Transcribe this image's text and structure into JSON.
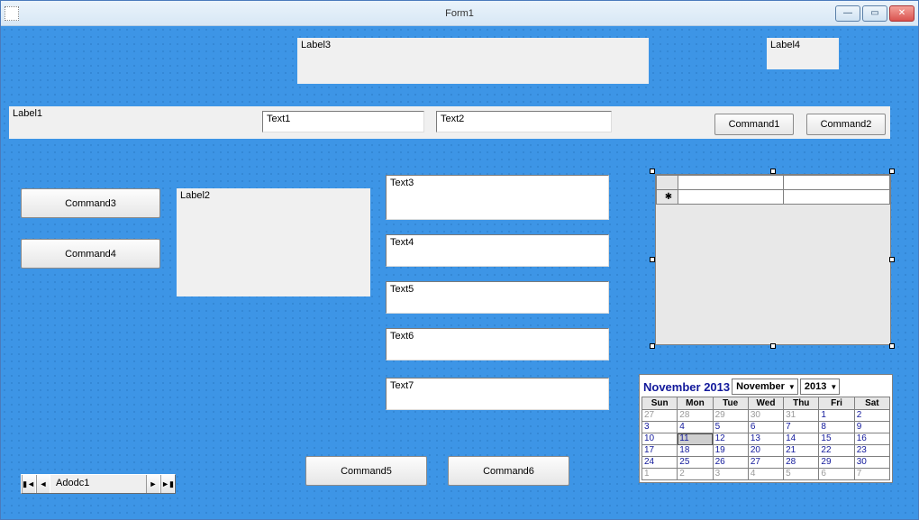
{
  "window": {
    "title": "Form1"
  },
  "labels": {
    "label1": "Label1",
    "label2": "Label2",
    "label3": "Label3",
    "label4": "Label4"
  },
  "texts": {
    "text1": "Text1",
    "text2": "Text2",
    "text3": "Text3",
    "text4": "Text4",
    "text5": "Text5",
    "text6": "Text6",
    "text7": "Text7"
  },
  "buttons": {
    "command1": "Command1",
    "command2": "Command2",
    "command3": "Command3",
    "command4": "Command4",
    "command5": "Command5",
    "command6": "Command6"
  },
  "adodc": {
    "caption": "Adodc1"
  },
  "grid": {
    "new_row_marker": "✱"
  },
  "calendar": {
    "title": "November 2013",
    "month_select": "November",
    "year_select": "2013",
    "day_headers": [
      "Sun",
      "Mon",
      "Tue",
      "Wed",
      "Thu",
      "Fri",
      "Sat"
    ],
    "rows": [
      [
        {
          "d": "27",
          "dim": true
        },
        {
          "d": "28",
          "dim": true
        },
        {
          "d": "29",
          "dim": true
        },
        {
          "d": "30",
          "dim": true
        },
        {
          "d": "31",
          "dim": true
        },
        {
          "d": "1"
        },
        {
          "d": "2"
        }
      ],
      [
        {
          "d": "3"
        },
        {
          "d": "4"
        },
        {
          "d": "5"
        },
        {
          "d": "6"
        },
        {
          "d": "7"
        },
        {
          "d": "8"
        },
        {
          "d": "9"
        }
      ],
      [
        {
          "d": "10"
        },
        {
          "d": "11",
          "today": true
        },
        {
          "d": "12"
        },
        {
          "d": "13"
        },
        {
          "d": "14"
        },
        {
          "d": "15"
        },
        {
          "d": "16"
        }
      ],
      [
        {
          "d": "17"
        },
        {
          "d": "18"
        },
        {
          "d": "19"
        },
        {
          "d": "20"
        },
        {
          "d": "21"
        },
        {
          "d": "22"
        },
        {
          "d": "23"
        }
      ],
      [
        {
          "d": "24"
        },
        {
          "d": "25"
        },
        {
          "d": "26"
        },
        {
          "d": "27"
        },
        {
          "d": "28"
        },
        {
          "d": "29"
        },
        {
          "d": "30"
        }
      ],
      [
        {
          "d": "1",
          "dim": true
        },
        {
          "d": "2",
          "dim": true
        },
        {
          "d": "3",
          "dim": true
        },
        {
          "d": "4",
          "dim": true
        },
        {
          "d": "5",
          "dim": true
        },
        {
          "d": "6",
          "dim": true
        },
        {
          "d": "7",
          "dim": true
        }
      ]
    ]
  }
}
